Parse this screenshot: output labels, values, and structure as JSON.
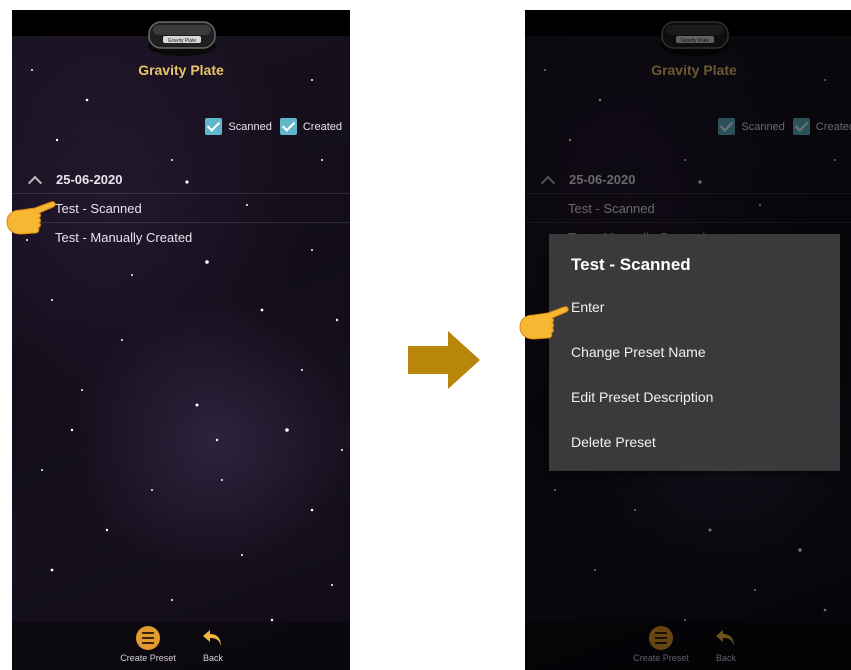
{
  "app": {
    "title": "Gravity Plate",
    "device_label": "Gravity Plate"
  },
  "filters": {
    "scanned_label": "Scanned",
    "created_label": "Created",
    "scanned_checked": true,
    "created_checked": true
  },
  "group": {
    "date": "25-06-2020"
  },
  "presets": [
    {
      "label": "Test - Scanned"
    },
    {
      "label": "Test - Manually Created"
    }
  ],
  "bottom_nav": {
    "create_label": "Create Preset",
    "back_label": "Back"
  },
  "context_menu": {
    "title": "Test - Scanned",
    "items": [
      {
        "label": "Enter"
      },
      {
        "label": "Change Preset Name"
      },
      {
        "label": "Edit Preset Description"
      },
      {
        "label": "Delete Preset"
      }
    ]
  },
  "colors": {
    "accent": "#e8c46a",
    "checkbox": "#5fb7c9",
    "dialog_bg": "#3a3a3a",
    "arrow": "#b8860b",
    "create_icon": "#e39a2c"
  }
}
